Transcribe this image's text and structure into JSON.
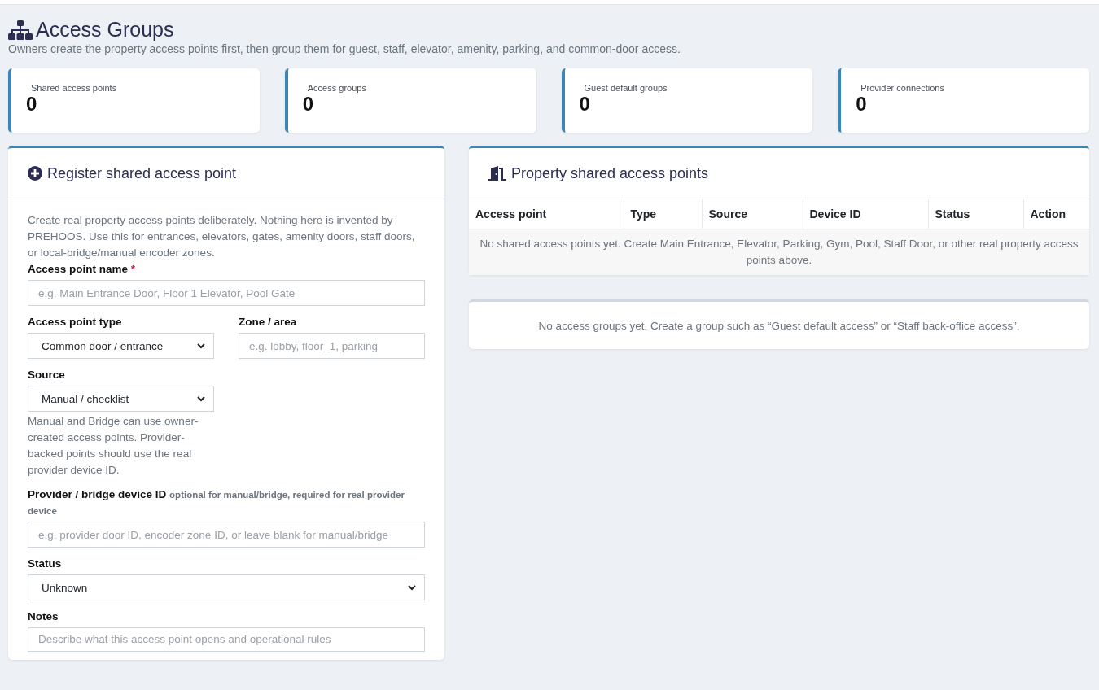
{
  "page": {
    "title": "Access Groups",
    "subtitle": "Owners create the property access points first, then group them for guest, staff, elevator, amenity, parking, and common-door access."
  },
  "stats": [
    {
      "label": "Shared access points",
      "value": "0"
    },
    {
      "label": "Access groups",
      "value": "0"
    },
    {
      "label": "Guest default groups",
      "value": "0"
    },
    {
      "label": "Provider connections",
      "value": "0"
    }
  ],
  "register_panel": {
    "title": "Register shared access point",
    "intro": "Create real property access points deliberately. Nothing here is invented by PREHOOS. Use this for entrances, elevators, gates, amenity doors, staff doors, or local-bridge/manual encoder zones.",
    "rows": [
      [
        {
          "kind": "text",
          "label": "Access point name",
          "required_mark": "*",
          "placeholder": "e.g. Main Entrance Door, Floor 1 Elevator, Pool Gate"
        }
      ],
      [
        {
          "kind": "select",
          "label": "Access point type",
          "value": "Common door / entrance"
        },
        {
          "kind": "text",
          "label": "Zone / area",
          "placeholder": "e.g. lobby, floor_1, parking"
        }
      ],
      [
        {
          "kind": "select",
          "label": "Source",
          "value": "Manual / checklist",
          "help": "Manual and Bridge can use owner-created access points. Provider-backed points should use the real provider device ID."
        }
      ],
      [
        {
          "kind": "text",
          "label": "Provider / bridge device ID",
          "note": "optional for manual/bridge, required for real provider device",
          "placeholder": "e.g. provider door ID, encoder zone ID, or leave blank for manual/bridge"
        }
      ],
      [
        {
          "kind": "select",
          "label": "Status",
          "value": "Unknown"
        }
      ],
      [
        {
          "kind": "textarea",
          "label": "Notes",
          "placeholder": "Describe what this access point opens and operational rules"
        }
      ]
    ]
  },
  "access_points_panel": {
    "title": "Property shared access points",
    "columns": [
      "Access point",
      "Type",
      "Source",
      "Device ID",
      "Status",
      "Action"
    ],
    "empty_message": "No shared access points yet. Create Main Entrance, Elevator, Parking, Gym, Pool, Staff Door, or other real property access points above."
  },
  "groups_panel": {
    "empty_message": "No access groups yet. Create a group such as “Guest default access” or “Staff back-office access”."
  }
}
